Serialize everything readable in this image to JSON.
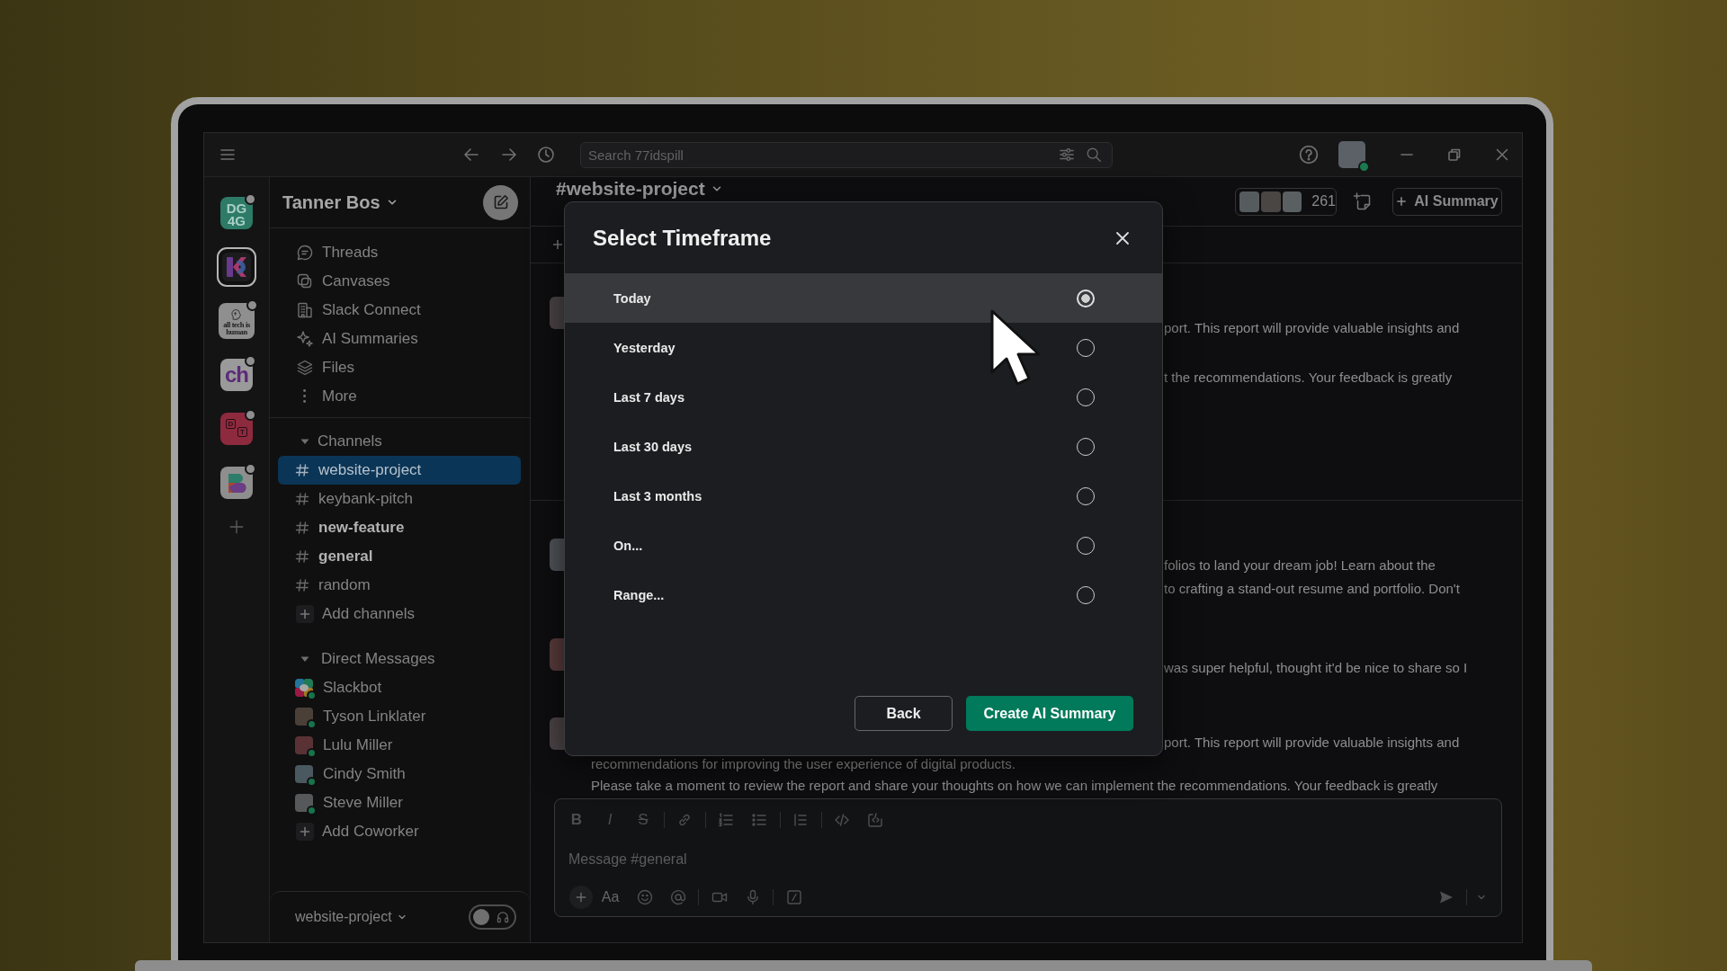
{
  "topbar": {
    "search": {
      "placeholder": "Search 77idspill"
    },
    "user": {
      "online": true
    }
  },
  "workspaces": [
    {
      "kind": "monogram",
      "lines": [
        "DG",
        "4G"
      ],
      "selected": false,
      "unread": true
    },
    {
      "kind": "k-mark",
      "selected": true,
      "unread": false
    },
    {
      "kind": "head-badge",
      "caption": "all tech is human",
      "selected": false,
      "unread": true
    },
    {
      "kind": "letters",
      "text": "ch",
      "selected": false,
      "unread": true
    },
    {
      "kind": "chat-boxes",
      "marks": [
        "D",
        "T"
      ],
      "selected": false,
      "unread": true
    },
    {
      "kind": "swirl",
      "selected": false,
      "unread": true
    }
  ],
  "sidebar": {
    "workspace": "Tanner Bos",
    "nav": [
      {
        "kind": "threads",
        "label": "Threads"
      },
      {
        "kind": "canvases",
        "label": "Canvases"
      },
      {
        "kind": "connect",
        "label": "Slack Connect"
      },
      {
        "kind": "ai",
        "label": "AI Summaries"
      },
      {
        "kind": "files",
        "label": "Files"
      },
      {
        "kind": "more",
        "label": "More"
      }
    ],
    "sections": [
      {
        "kind": "channels",
        "title": "Channels",
        "expanded": true,
        "items": [
          {
            "name": "website-project",
            "selected": true,
            "unread": false
          },
          {
            "name": "keybank-pitch",
            "selected": false,
            "unread": false
          },
          {
            "name": "new-feature",
            "selected": false,
            "unread": true
          },
          {
            "name": "general",
            "selected": false,
            "unread": true
          },
          {
            "name": "random",
            "selected": false,
            "unread": false
          }
        ],
        "add_label": "Add channels"
      },
      {
        "kind": "dms",
        "title": "Direct Messages",
        "expanded": true,
        "items": [
          {
            "name": "Slackbot",
            "kind": "bot",
            "selected": false,
            "online": true
          },
          {
            "name": "Tyson Linklater",
            "kind": "person",
            "selected": false,
            "online": true
          },
          {
            "name": "Lulu Miller",
            "kind": "person",
            "selected": false,
            "online": true
          },
          {
            "name": "Cindy Smith",
            "kind": "person",
            "selected": false,
            "online": true
          },
          {
            "name": "Steve Miller",
            "kind": "person",
            "selected": false,
            "online": true
          }
        ],
        "add_label": "Add Coworker"
      }
    ],
    "footer": {
      "channel": "website-project",
      "huddle_on": false
    }
  },
  "channel": {
    "title": "#website-project",
    "members": "261",
    "summary_button": "AI Summary"
  },
  "messages": [
    {
      "lines": [
        {
          "kind": "clipped",
          "text": "port. This report will provide valuable insights and"
        },
        {
          "kind": "clipped",
          "text": "t the recommendations. Your feedback is greatly"
        }
      ]
    },
    {
      "lines": [
        {
          "kind": "clipped",
          "text": "folios to land your dream job! Learn about the"
        },
        {
          "kind": "clipped",
          "text": "to crafting a stand-out resume and portfolio. Don't"
        }
      ]
    },
    {
      "lines": [
        {
          "kind": "clipped",
          "text": "was super helpful, thought it'd be nice to share so I"
        }
      ]
    },
    {
      "lines": [
        {
          "kind": "clipped",
          "text": "port. This report will provide valuable insights and"
        },
        {
          "kind": "full",
          "text": "recommendations for improving the user experience of digital products."
        },
        {
          "kind": "full",
          "text": "Please take a moment to review the report and share your thoughts on how we can implement the recommendations. Your feedback is greatly"
        }
      ]
    }
  ],
  "composer": {
    "format": [
      {
        "kind": "bold",
        "glyph": "B"
      },
      {
        "kind": "italic",
        "glyph": "I"
      },
      {
        "kind": "strike",
        "glyph": "S"
      }
    ],
    "placeholder": "Message #general",
    "text_style": "Aa"
  },
  "dialog": {
    "title": "Select Timeframe",
    "options": [
      {
        "label": "Today",
        "selected": true
      },
      {
        "label": "Yesterday",
        "selected": false
      },
      {
        "label": "Last 7 days",
        "selected": false
      },
      {
        "label": "Last 30 days",
        "selected": false
      },
      {
        "label": "Last 3 months",
        "selected": false
      },
      {
        "label": "On...",
        "selected": false
      },
      {
        "label": "Range...",
        "selected": false
      }
    ],
    "buttons": [
      {
        "kind": "secondary",
        "label": "Back"
      },
      {
        "kind": "primary",
        "label": "Create AI Summary"
      }
    ]
  }
}
